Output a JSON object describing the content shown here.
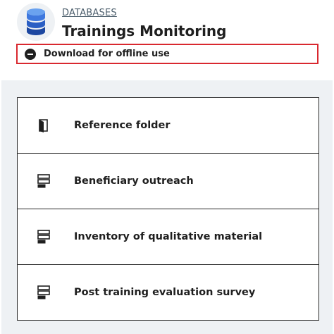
{
  "header": {
    "breadcrumb": "DATABASES",
    "title": "Trainings Monitoring",
    "icon": "database-icon",
    "icon_color": "#2b5fc4"
  },
  "offline_button": {
    "label": "Download for offline use",
    "icon": "minus-circle-icon",
    "border_color": "#d9282f"
  },
  "items": [
    {
      "label": "Reference folder",
      "icon": "folder-icon"
    },
    {
      "label": "Beneficiary outreach",
      "icon": "form-icon"
    },
    {
      "label": "Inventory of qualitative material",
      "icon": "form-icon"
    },
    {
      "label": "Post training evaluation survey",
      "icon": "form-icon"
    }
  ]
}
